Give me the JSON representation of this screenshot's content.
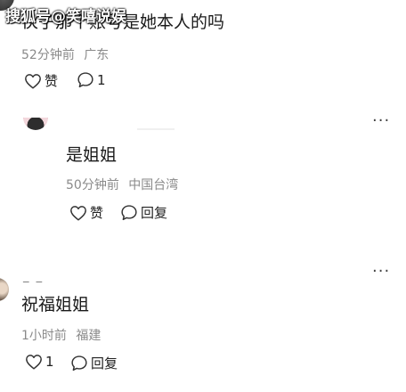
{
  "watermark": "搜狐号@笑嘻说娱",
  "comments": [
    {
      "text": "伙子那个账号是她本人的吗",
      "time": "52分钟前",
      "location": "广东",
      "like_label": "赞",
      "reply_count": "1"
    },
    {
      "text": "是姐姐",
      "time": "50分钟前",
      "location": "中国台湾",
      "like_label": "赞",
      "reply_label": "回复"
    },
    {
      "user_name": "_ _",
      "text": "祝福姐姐",
      "time": "1小时前",
      "location": "福建",
      "like_count": "1",
      "reply_label": "回复"
    }
  ],
  "more_glyph": "···",
  "icons": {
    "like": "heart-outline-icon",
    "reply": "speech-bubble-icon",
    "more": "more-horizontal-icon"
  },
  "colors": {
    "text": "#1a1a1a",
    "meta": "#8a8a8a",
    "icon": "#333333"
  }
}
